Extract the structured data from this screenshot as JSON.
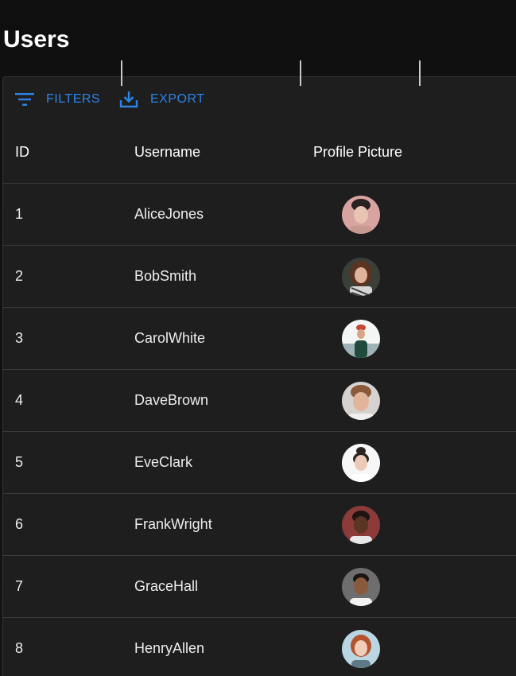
{
  "page": {
    "title": "Users"
  },
  "toolbar": {
    "filters_label": "FILTERS",
    "export_label": "EXPORT",
    "accent_color": "#2b84e6"
  },
  "columns": {
    "id": "ID",
    "username": "Username",
    "picture": "Profile Picture"
  },
  "rows": [
    {
      "id": "1",
      "username": "AliceJones",
      "avatar": "portrait-photo"
    },
    {
      "id": "2",
      "username": "BobSmith",
      "avatar": "portrait-photo"
    },
    {
      "id": "3",
      "username": "CarolWhite",
      "avatar": "portrait-photo"
    },
    {
      "id": "4",
      "username": "DaveBrown",
      "avatar": "portrait-photo"
    },
    {
      "id": "5",
      "username": "EveClark",
      "avatar": "portrait-photo"
    },
    {
      "id": "6",
      "username": "FrankWright",
      "avatar": "portrait-photo"
    },
    {
      "id": "7",
      "username": "GraceHall",
      "avatar": "portrait-photo"
    },
    {
      "id": "8",
      "username": "HenryAllen",
      "avatar": "portrait-photo"
    }
  ]
}
